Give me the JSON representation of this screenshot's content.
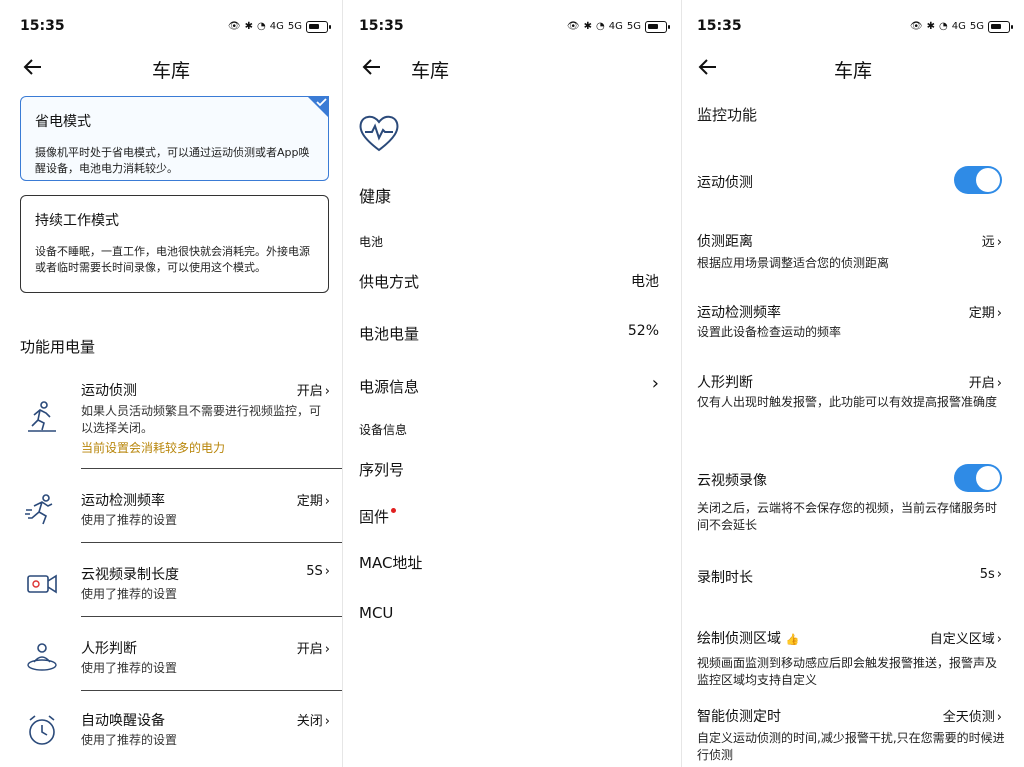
{
  "status": {
    "time": "15:35",
    "net_4g": "4G",
    "net_5g": "5G"
  },
  "nav": {
    "title": "车库"
  },
  "panel1": {
    "modes": [
      {
        "title": "省电模式",
        "desc": "摄像机平时处于省电模式，可以通过运动侦测或者App唤醒设备，电池电力消耗较少。",
        "selected": true
      },
      {
        "title": "持续工作模式",
        "desc": "设备不睡眠，一直工作，电池很快就会消耗完。外接电源或者临时需要长时间录像，可以使用这个模式。",
        "selected": false
      }
    ],
    "section_title": "功能用电量",
    "features": [
      {
        "name": "运动侦测",
        "value": "开启",
        "desc": "如果人员活动频繁且不需要进行视频监控，可以选择关闭。",
        "warn": "当前设置会消耗较多的电力",
        "icon": "running-man-icon"
      },
      {
        "name": "运动检测频率",
        "value": "定期",
        "desc": "使用了推荐的设置",
        "icon": "sprinting-man-icon"
      },
      {
        "name": "云视频录制长度",
        "value": "5S",
        "desc": "使用了推荐的设置",
        "icon": "video-camera-icon"
      },
      {
        "name": "人形判断",
        "value": "开启",
        "desc": "使用了推荐的设置",
        "icon": "person-detect-icon"
      },
      {
        "name": "自动唤醒设备",
        "value": "关闭",
        "desc": "使用了推荐的设置",
        "icon": "alarm-clock-icon"
      }
    ]
  },
  "panel2": {
    "health_label": "健康",
    "battery_header": "电池",
    "power_source_label": "供电方式",
    "power_source_value": "电池",
    "battery_level_label": "电池电量",
    "battery_level_value": "52%",
    "power_info_label": "电源信息",
    "device_info_header": "设备信息",
    "serial_label": "序列号",
    "firmware_label": "固件",
    "mac_label": "MAC地址",
    "mcu_label": "MCU"
  },
  "panel3": {
    "section_title": "监控功能",
    "motion_detect": {
      "label": "运动侦测",
      "on": true
    },
    "detect_distance": {
      "label": "侦测距离",
      "value": "远",
      "desc": "根据应用场景调整适合您的侦测距离"
    },
    "detect_frequency": {
      "label": "运动检测频率",
      "value": "定期",
      "desc": "设置此设备检查运动的频率"
    },
    "human_detect": {
      "label": "人形判断",
      "value": "开启",
      "desc": "仅有人出现时触发报警，此功能可以有效提高报警准确度"
    },
    "cloud_record": {
      "label": "云视频录像",
      "on": true,
      "desc": "关闭之后，云端将不会保存您的视频，当前云存储服务时间不会延长"
    },
    "record_duration": {
      "label": "录制时长",
      "value": "5s"
    },
    "detect_zone": {
      "label": "绘制侦测区域",
      "value": "自定义区域",
      "desc": "视频画面监测到移动感应后即会触发报警推送，报警声及监控区域均支持自定义"
    },
    "smart_schedule": {
      "label": "智能侦测定时",
      "value": "全天侦测",
      "desc": "自定义运动侦测的时间,减少报警干扰,只在您需要的时候进行侦测"
    }
  },
  "colors": {
    "accent": "#2f8be6",
    "warn": "#b8860b",
    "selected_border": "#3a7bd5"
  }
}
